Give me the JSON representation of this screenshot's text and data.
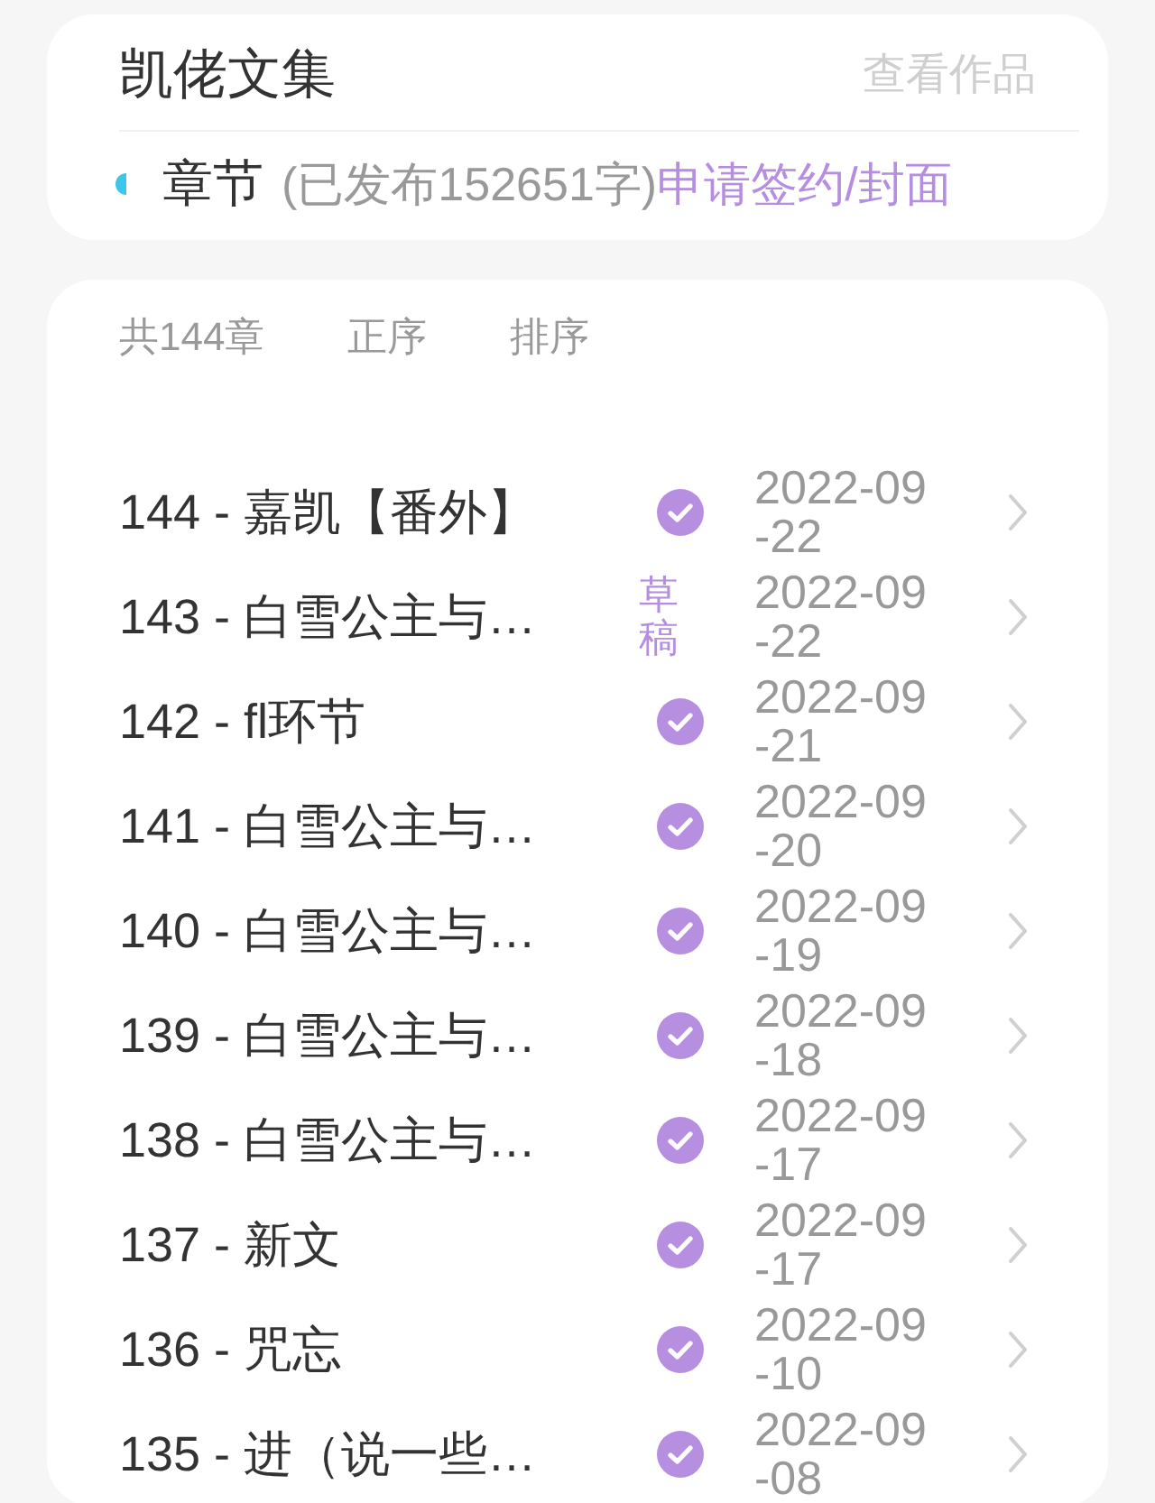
{
  "work": {
    "title": "凯佬文集",
    "view_link": "查看作品"
  },
  "chapters_bar": {
    "label": "章节",
    "published": "(已发布152651字)",
    "apply_link": "申请签约/封面"
  },
  "list_header": {
    "count": "共144章",
    "order": "正序",
    "sort": "排序"
  },
  "chapters": [
    {
      "title": "144 - 嘉凯【番外】",
      "kind": "published",
      "date": "2022-09-22"
    },
    {
      "title": "143 - 白雪公主与…",
      "kind": "draft",
      "status_text": "草稿",
      "date": "2022-09-22"
    },
    {
      "title": "142 - fl环节",
      "kind": "published",
      "date": "2022-09-21"
    },
    {
      "title": "141 - 白雪公主与…",
      "kind": "published",
      "date": "2022-09-20"
    },
    {
      "title": "140 - 白雪公主与…",
      "kind": "published",
      "date": "2022-09-19"
    },
    {
      "title": "139 - 白雪公主与…",
      "kind": "published",
      "date": "2022-09-18"
    },
    {
      "title": "138 - 白雪公主与…",
      "kind": "published",
      "date": "2022-09-17"
    },
    {
      "title": "137 - 新文",
      "kind": "published",
      "date": "2022-09-17"
    },
    {
      "title": "136 - 咒忘",
      "kind": "published",
      "date": "2022-09-10"
    },
    {
      "title": "135 - 进（说一些…",
      "kind": "published",
      "date": "2022-09-08"
    }
  ]
}
